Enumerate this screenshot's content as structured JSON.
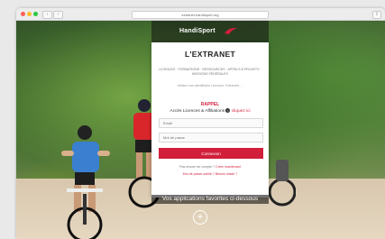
{
  "browser": {
    "url": "extranet.handisport.org",
    "back_label": "‹",
    "forward_label": "›",
    "share_label": "⇪"
  },
  "brand": {
    "name": "HandiSport",
    "accent": "#d11f3b"
  },
  "login": {
    "title": "L'EXTRANET",
    "subtitle": "LICENCES · FORMATIONS · RESSOURCES · APPELS À PROJETS · MISSIONS FÉDÉRALES",
    "hint": "Utilisez vos identifiants Licences, Extranets ...",
    "rappel": "RAPPEL",
    "access_text": "Accès Licences & Affiliations",
    "access_link": "cliquez ici",
    "email_placeholder": "Email",
    "password_placeholder": "Mot de passe",
    "submit_label": "Connexion",
    "no_account_text": "Pas encore de compte ?",
    "no_account_link": "Créer maintenant",
    "forgot_text": "Mot de passe oublié ?",
    "forgot_link": "Besoin d'aide ?",
    "apps_label": "Vos applications favorites ci-dessous",
    "plus_label": "+"
  }
}
